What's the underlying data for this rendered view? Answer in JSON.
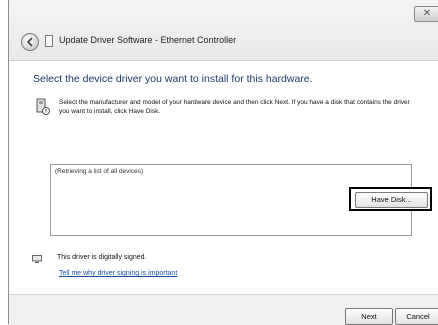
{
  "window": {
    "title": "Update Driver Software - Ethernet Controller",
    "close_glyph": "✕"
  },
  "main": {
    "heading": "Select the device driver you want to install for this hardware.",
    "instruction": "Select the manufacturer and model of your hardware device and then click Next. If you have a disk that contains the driver you want to install, click Have Disk.",
    "device_list_status": "(Retrieving a list of all devices)",
    "signed_text": "This driver is digitally signed.",
    "signing_link": "Tell me why driver signing is important",
    "have_disk_label": "Have Disk..."
  },
  "footer": {
    "next_label": "Next",
    "cancel_label": "Cancel"
  },
  "icons": {
    "back": "back-arrow-icon",
    "title": "window-icon",
    "hardware": "hardware-info-icon",
    "signed": "driver-signed-icon"
  }
}
